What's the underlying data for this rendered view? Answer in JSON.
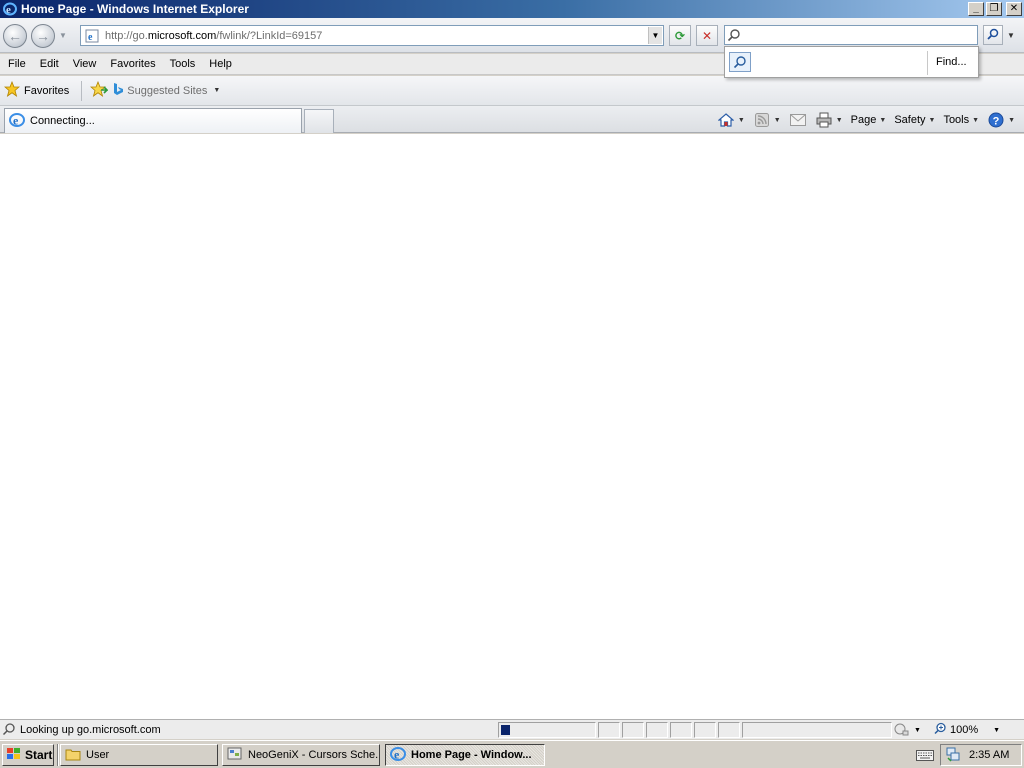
{
  "window": {
    "title": "Home Page - Windows Internet Explorer",
    "min": "_",
    "restore": "❐",
    "close": "✕"
  },
  "address": {
    "url_prefix": "http://go.",
    "url_domain": "microsoft.com",
    "url_suffix": "/fwlink/?LinkId=69157",
    "dropdown": "▼"
  },
  "nav": {
    "back": "←",
    "forward": "→",
    "recent_caret": "▼",
    "refresh": "⟳",
    "stop": "✕"
  },
  "search": {
    "value": "",
    "find_label": "Find...",
    "dropdown": "▼"
  },
  "menu": [
    "File",
    "Edit",
    "View",
    "Favorites",
    "Tools",
    "Help"
  ],
  "favorites_bar": {
    "favorites_label": "Favorites",
    "suggested_sites": "Suggested Sites",
    "caret": "▼"
  },
  "tab": {
    "title": "Connecting..."
  },
  "commands": {
    "page": "Page",
    "safety": "Safety",
    "tools": "Tools",
    "caret": "▼"
  },
  "status": {
    "text": "Looking up go.microsoft.com",
    "progress": 0.1,
    "zoom": "100%",
    "zoom_caret": "▼",
    "protect_caret": "▼"
  },
  "taskbar": {
    "start": "Start",
    "buttons": [
      {
        "label": "User"
      },
      {
        "label": "NeoGeniX - Cursors Sche..."
      },
      {
        "label": "Home Page - Window..."
      }
    ],
    "clock": "2:35 AM"
  },
  "colors": {
    "titlebar_start": "#0a246a",
    "progress": "#0a246a",
    "content_bg": "#ffffff"
  }
}
